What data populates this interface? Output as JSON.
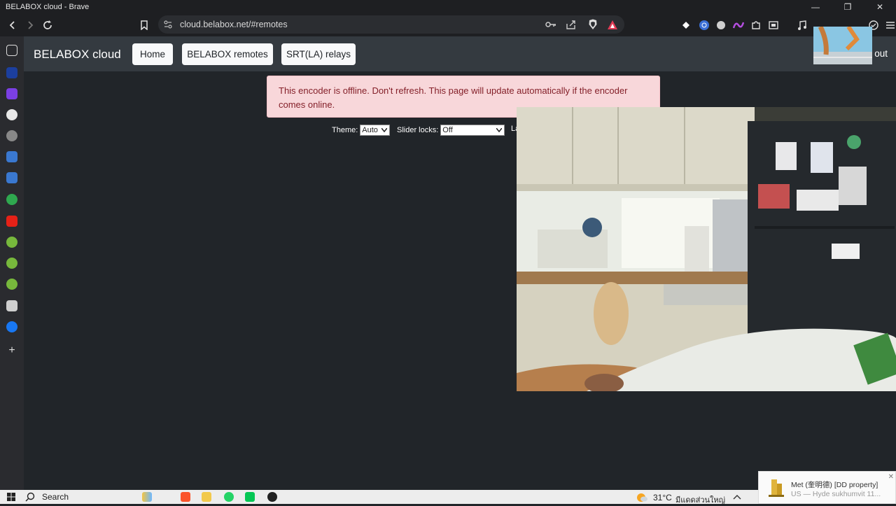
{
  "window": {
    "title": "BELABOX cloud - Brave",
    "controls": {
      "minimize": "—",
      "maximize": "❐",
      "close": "✕"
    }
  },
  "browser": {
    "url": "cloud.belabox.net/#remotes",
    "nav": {
      "back_icon": "chevron-left-icon",
      "forward_icon": "chevron-right-icon",
      "reload_icon": "reload-icon",
      "bookmark_icon": "bookmark-icon"
    }
  },
  "page": {
    "brand": "BELABOX cloud",
    "nav_buttons": [
      "Home",
      "BELABOX remotes",
      "SRT(LA) relays"
    ],
    "logout_partial": "out",
    "alert": "This encoder is offline. Don't refresh. This page will update automatically if the encoder comes online.",
    "settings": {
      "theme_label": "Theme:",
      "theme_value": "Auto",
      "slider_label": "Slider locks:",
      "slider_value": "Off",
      "third_label_partial": "La"
    }
  },
  "taskbar": {
    "search_label": "Search",
    "weather": "31°C",
    "weather_desc": "มีแดดส่วนใหญ่",
    "notification": {
      "title": "Met (奎明德) [DD property]",
      "body": "US — Hyde sukhumvit 11..."
    }
  },
  "colors": {
    "page_bg": "#212529",
    "navbar_bg": "#343a40",
    "alert_bg": "#f8d7da",
    "alert_text": "#842029"
  }
}
